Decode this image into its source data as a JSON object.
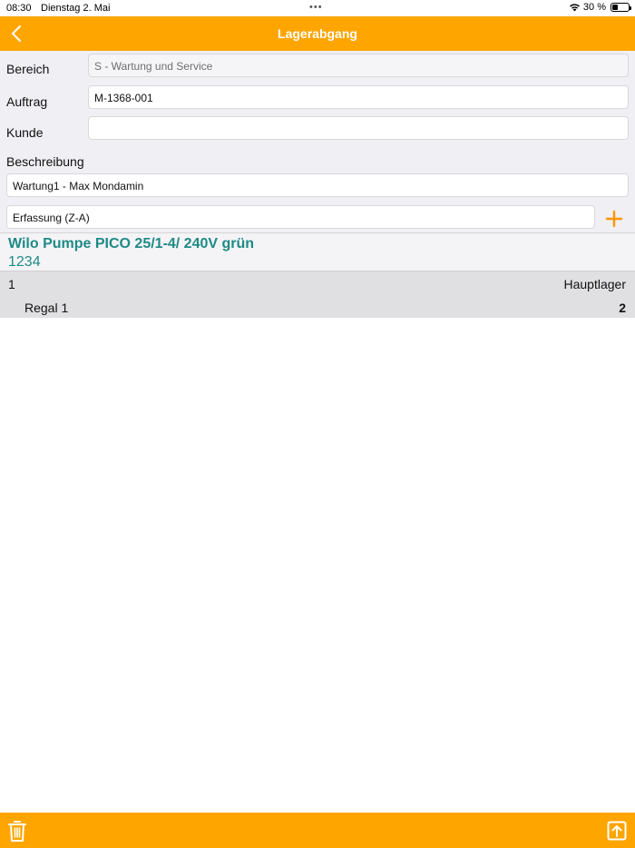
{
  "status_bar": {
    "time": "08:30",
    "date": "Dienstag 2. Mai",
    "dots": "•••",
    "battery": "30 %"
  },
  "nav": {
    "title": "Lagerabgang",
    "back_icon": "chevron-left-icon"
  },
  "form": {
    "bereich_label": "Bereich",
    "bereich_value": "S - Wartung und Service",
    "auftrag_label": "Auftrag",
    "auftrag_value": "M-1368-001",
    "kunde_label": "Kunde",
    "kunde_value": "",
    "beschreibung_label": "Beschreibung",
    "beschreibung_value": "Wartung1 - Max Mondamin",
    "erfassung_value": "Erfassung (Z-A)"
  },
  "product": {
    "name": "Wilo Pumpe PICO 25/1-4/ 240V grün",
    "number": "1234"
  },
  "stock": {
    "quantity": "1",
    "warehouse": "Hauptlager",
    "shelf": "Regal 1",
    "count": "2"
  },
  "colors": {
    "accent": "#ffa500",
    "product_text": "#1e8a86"
  }
}
